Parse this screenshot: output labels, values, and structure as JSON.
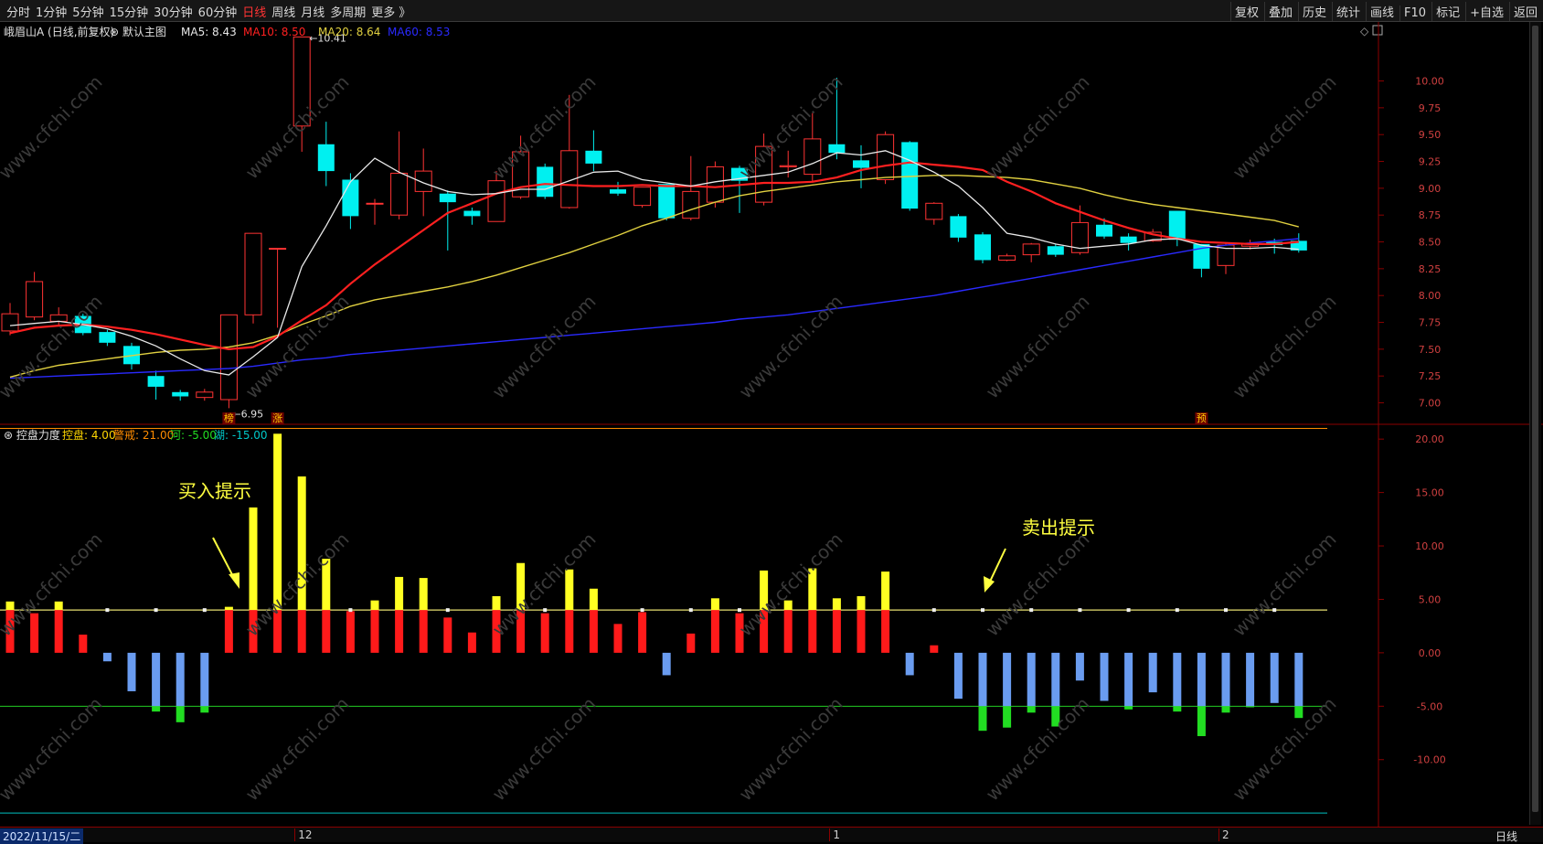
{
  "toolbar": {
    "left": [
      "分时",
      "1分钟",
      "5分钟",
      "15分钟",
      "30分钟",
      "60分钟",
      "日线",
      "周线",
      "月线",
      "多周期",
      "更多 》"
    ],
    "active": "日线",
    "right": [
      "复权",
      "叠加",
      "历史",
      "统计",
      "画线",
      "F10",
      "标记",
      "+自选",
      "返回"
    ]
  },
  "main_header": {
    "stock": "峨眉山A (日线,前复权)",
    "template": "默认主图",
    "ma5": "MA5: 8.43",
    "ma10": "MA10: 8.50",
    "ma20": "MA20: 8.64",
    "ma60": "MA60: 8.53"
  },
  "sub_header": {
    "name": "控盘力度",
    "kp": "控盘: 4.00",
    "jj": "警戒: 21.00",
    "he": "河: -5.00",
    "hu": "湖: -15.00"
  },
  "annotations": {
    "buy": "买入提示",
    "sell": "卖出提示",
    "high": "10.41",
    "low": "6.95"
  },
  "markers": [
    "榜",
    "涨",
    "预"
  ],
  "bottom": {
    "date": "2022/11/15/二",
    "months": [
      "12",
      "1",
      "2"
    ],
    "period": "日线"
  },
  "watermark": "www.cfchi.com",
  "colors": {
    "up": "#ff3333",
    "down": "#00f0f0",
    "ma5": "#e8e8e8",
    "ma10": "#ff2020",
    "ma20": "#e0d040",
    "ma60": "#2a2aff",
    "bar_red": "#ff1a1a",
    "bar_yellow": "#ffff22",
    "bar_blue": "#6a9cf0",
    "bar_green": "#22dd22"
  },
  "chart_data": [
    {
      "type": "candlestick",
      "ylim": [
        6.8,
        10.55
      ],
      "y_ticks": [
        7.0,
        7.25,
        7.5,
        7.75,
        8.0,
        8.25,
        8.5,
        8.75,
        9.0,
        9.25,
        9.5,
        9.75,
        10.0
      ],
      "candles": [
        [
          7.67,
          7.83,
          7.93,
          7.63
        ],
        [
          7.8,
          8.13,
          8.22,
          7.77
        ],
        [
          7.76,
          7.82,
          7.89,
          7.72
        ],
        [
          7.81,
          7.65,
          7.83,
          7.63
        ],
        [
          7.66,
          7.56,
          7.68,
          7.53
        ],
        [
          7.53,
          7.36,
          7.56,
          7.31
        ],
        [
          7.25,
          7.15,
          7.3,
          7.03
        ],
        [
          7.1,
          7.06,
          7.12,
          7.02
        ],
        [
          7.05,
          7.1,
          7.13,
          7.02
        ],
        [
          7.03,
          7.82,
          7.82,
          6.95
        ],
        [
          7.82,
          8.58,
          8.58,
          7.74
        ],
        [
          8.44,
          8.44,
          8.44,
          7.7
        ],
        [
          9.58,
          10.41,
          10.41,
          9.34
        ],
        [
          9.41,
          9.16,
          9.62,
          9.02
        ],
        [
          9.08,
          8.74,
          9.14,
          8.62
        ],
        [
          8.86,
          8.86,
          8.9,
          8.66
        ],
        [
          8.75,
          9.14,
          9.53,
          8.71
        ],
        [
          8.97,
          9.16,
          9.37,
          8.74
        ],
        [
          8.95,
          8.87,
          8.98,
          8.42
        ],
        [
          8.79,
          8.74,
          8.82,
          8.66
        ],
        [
          8.69,
          9.07,
          9.16,
          8.69
        ],
        [
          8.92,
          9.34,
          9.49,
          8.9
        ],
        [
          9.2,
          8.92,
          9.23,
          8.9
        ],
        [
          8.82,
          9.35,
          9.87,
          8.81
        ],
        [
          9.35,
          9.23,
          9.54,
          9.16
        ],
        [
          8.99,
          8.95,
          9.06,
          8.93
        ],
        [
          8.84,
          9.01,
          9.01,
          8.82
        ],
        [
          9.04,
          8.72,
          9.04,
          8.7
        ],
        [
          8.72,
          8.97,
          9.3,
          8.7
        ],
        [
          8.87,
          9.2,
          9.25,
          8.82
        ],
        [
          9.19,
          9.07,
          9.21,
          8.77
        ],
        [
          8.87,
          9.39,
          9.51,
          8.84
        ],
        [
          9.2,
          9.21,
          9.35,
          9.1
        ],
        [
          9.13,
          9.46,
          9.7,
          9.06
        ],
        [
          9.41,
          9.33,
          10.03,
          9.27
        ],
        [
          9.26,
          9.19,
          9.4,
          9.0
        ],
        [
          9.08,
          9.5,
          9.53,
          9.04
        ],
        [
          9.43,
          8.81,
          9.44,
          8.79
        ],
        [
          8.71,
          8.86,
          8.87,
          8.66
        ],
        [
          8.74,
          8.54,
          8.76,
          8.5
        ],
        [
          8.57,
          8.33,
          8.59,
          8.3
        ],
        [
          8.33,
          8.37,
          8.39,
          8.32
        ],
        [
          8.38,
          8.48,
          8.49,
          8.31
        ],
        [
          8.46,
          8.38,
          8.48,
          8.36
        ],
        [
          8.4,
          8.68,
          8.84,
          8.38
        ],
        [
          8.66,
          8.55,
          8.72,
          8.53
        ],
        [
          8.55,
          8.49,
          8.58,
          8.42
        ],
        [
          8.51,
          8.59,
          8.62,
          8.5
        ],
        [
          8.79,
          8.52,
          8.79,
          8.46
        ],
        [
          8.48,
          8.25,
          8.48,
          8.17
        ],
        [
          8.28,
          8.47,
          8.49,
          8.2
        ],
        [
          8.46,
          8.48,
          8.52,
          8.43
        ],
        [
          8.5,
          8.47,
          8.53,
          8.39
        ],
        [
          8.51,
          8.42,
          8.58,
          8.4
        ]
      ],
      "ma5": [
        7.72,
        7.74,
        7.76,
        7.73,
        7.69,
        7.62,
        7.53,
        7.41,
        7.3,
        7.26,
        7.43,
        7.61,
        8.27,
        8.65,
        9.06,
        9.28,
        9.15,
        9.05,
        8.97,
        8.94,
        8.95,
        8.99,
        8.99,
        9.07,
        9.15,
        9.16,
        9.08,
        9.05,
        9.02,
        9.06,
        9.09,
        9.12,
        9.15,
        9.23,
        9.33,
        9.31,
        9.35,
        9.26,
        9.15,
        9.02,
        8.82,
        8.58,
        8.54,
        8.48,
        8.44,
        8.46,
        8.48,
        8.52,
        8.53,
        8.47,
        8.44,
        8.44,
        8.45,
        8.43
      ],
      "ma10": [
        7.65,
        7.7,
        7.72,
        7.73,
        7.71,
        7.68,
        7.64,
        7.59,
        7.54,
        7.5,
        7.52,
        7.62,
        7.77,
        7.91,
        8.11,
        8.29,
        8.45,
        8.61,
        8.77,
        8.86,
        8.95,
        9.01,
        9.04,
        9.03,
        9.02,
        9.02,
        9.03,
        9.02,
        9.02,
        9.01,
        9.03,
        9.05,
        9.05,
        9.06,
        9.1,
        9.17,
        9.21,
        9.24,
        9.22,
        9.2,
        9.17,
        9.06,
        8.97,
        8.86,
        8.78,
        8.7,
        8.63,
        8.57,
        8.53,
        8.5,
        8.49,
        8.48,
        8.48,
        8.5
      ],
      "ma20": [
        7.24,
        7.3,
        7.35,
        7.38,
        7.41,
        7.44,
        7.47,
        7.49,
        7.5,
        7.52,
        7.56,
        7.63,
        7.73,
        7.81,
        7.9,
        7.96,
        8.0,
        8.04,
        8.08,
        8.13,
        8.19,
        8.26,
        8.33,
        8.4,
        8.48,
        8.56,
        8.65,
        8.72,
        8.8,
        8.87,
        8.93,
        8.97,
        9.0,
        9.03,
        9.06,
        9.08,
        9.1,
        9.11,
        9.12,
        9.12,
        9.11,
        9.1,
        9.08,
        9.04,
        9.0,
        8.94,
        8.89,
        8.85,
        8.82,
        8.79,
        8.76,
        8.73,
        8.7,
        8.64
      ],
      "ma60": [
        7.23,
        7.24,
        7.25,
        7.26,
        7.27,
        7.28,
        7.29,
        7.3,
        7.31,
        7.32,
        7.34,
        7.37,
        7.4,
        7.42,
        7.45,
        7.47,
        7.49,
        7.51,
        7.53,
        7.55,
        7.57,
        7.59,
        7.61,
        7.63,
        7.65,
        7.67,
        7.69,
        7.71,
        7.73,
        7.75,
        7.78,
        7.8,
        7.82,
        7.85,
        7.88,
        7.91,
        7.94,
        7.97,
        8.0,
        8.04,
        8.08,
        8.12,
        8.16,
        8.2,
        8.24,
        8.28,
        8.32,
        8.36,
        8.4,
        8.44,
        8.47,
        8.49,
        8.51,
        8.53
      ]
    },
    {
      "type": "bar",
      "title": "控盘力度",
      "ylim": [
        -14.9,
        20.7
      ],
      "y_ticks": [
        20.0,
        15.0,
        10.0,
        5.0,
        0.0,
        -5.0,
        -10.0
      ],
      "levels": {
        "kp": 4.0,
        "jj": 21.0,
        "he": -5.0,
        "hu": -15.0
      },
      "values": [
        4.8,
        3.7,
        4.8,
        1.7,
        -0.8,
        -3.6,
        -5.5,
        -6.5,
        -5.6,
        4.3,
        13.6,
        20.5,
        16.5,
        8.8,
        3.9,
        4.9,
        7.1,
        7.0,
        3.3,
        1.9,
        5.3,
        8.4,
        3.7,
        7.8,
        6.0,
        2.7,
        3.8,
        -2.1,
        1.8,
        5.1,
        3.7,
        7.7,
        4.9,
        7.9,
        5.1,
        5.3,
        7.6,
        -2.1,
        0.7,
        -4.3,
        -7.3,
        -7.0,
        -5.6,
        -6.9,
        -2.6,
        -4.5,
        -5.3,
        -3.7,
        -5.5,
        -7.8,
        -5.6,
        -5.1,
        -4.7,
        -6.1
      ],
      "marker_value": 4.0
    }
  ]
}
